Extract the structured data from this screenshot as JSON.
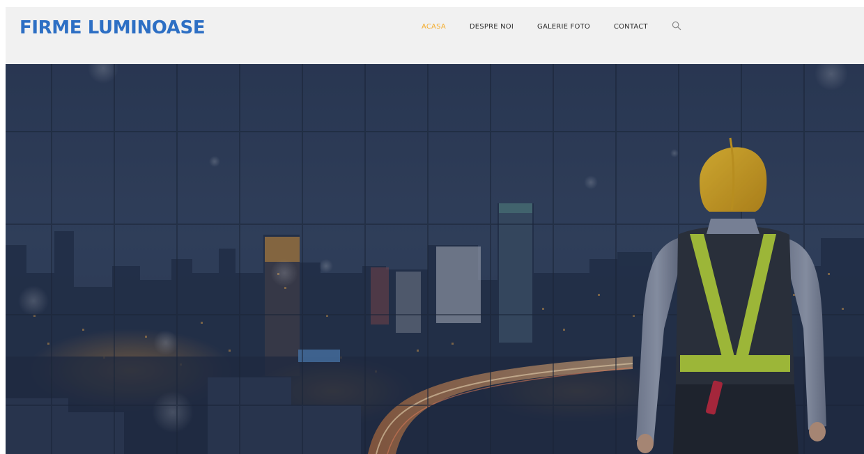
{
  "header": {
    "logo_text": "FIRME LUMINOASE"
  },
  "nav": {
    "items": [
      {
        "label": "ACASA",
        "active": true
      },
      {
        "label": "DESPRE NOI",
        "active": false
      },
      {
        "label": "GALERIE FOTO",
        "active": false
      },
      {
        "label": "CONTACT",
        "active": false
      }
    ],
    "search_icon": "search-icon"
  },
  "colors": {
    "brand": "#2d6fc4",
    "active_nav": "#f4ad2d",
    "header_bg": "#f1f1f1",
    "nav_text": "#2b2b2b",
    "hero_overlay": "#26344e"
  },
  "hero": {
    "image": "city-skyline-night-with-construction-worker"
  }
}
